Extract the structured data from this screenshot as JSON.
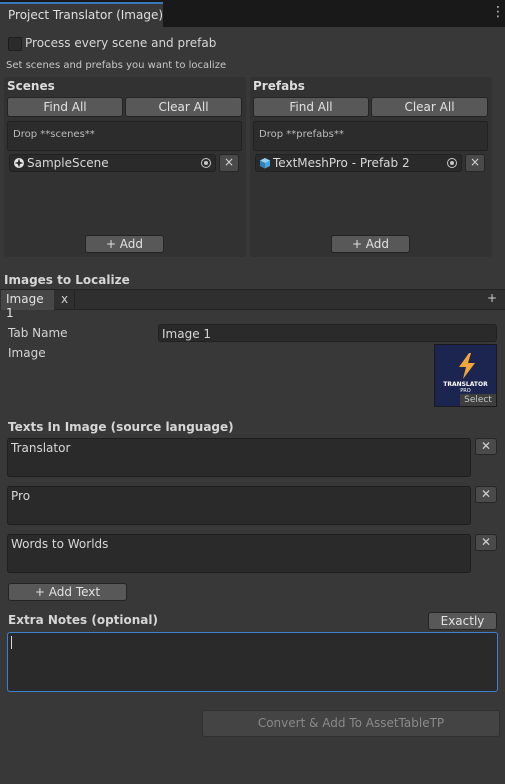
{
  "window": {
    "tab_title": "Project Translator (Image)"
  },
  "process_all": {
    "label": "Process every scene and prefab",
    "checked": false
  },
  "hint": "Set scenes and prefabs you want to localize",
  "scenes": {
    "title": "Scenes",
    "find_all": "Find All",
    "clear_all": "Clear All",
    "drop_hint": "Drop **scenes**",
    "items": [
      {
        "name": "SampleScene",
        "icon": "unity-scene-icon"
      }
    ],
    "add": "+ Add"
  },
  "prefabs": {
    "title": "Prefabs",
    "find_all": "Find All",
    "clear_all": "Clear All",
    "drop_hint": "Drop **prefabs**",
    "items": [
      {
        "name": "TextMeshPro - Prefab 2",
        "icon": "prefab-cube-icon"
      }
    ],
    "add": "+ Add"
  },
  "images": {
    "title": "Images to Localize",
    "tabs": [
      {
        "label": "Image 1",
        "close": "x"
      }
    ],
    "add_tab": "+",
    "tab_name_label": "Tab Name",
    "tab_name_value": "Image 1",
    "image_label": "Image",
    "thumbnail": {
      "line1": "TRANSLATOR",
      "line2": "PRO",
      "select": "Select"
    },
    "texts_title": "Texts In Image (source language)",
    "texts": [
      "Translator",
      "Pro",
      "Words to Worlds"
    ],
    "remove_text": "✕",
    "add_text": "+ Add Text",
    "extra_notes_title": "Extra Notes (optional)",
    "exactly": "Exactly",
    "extra_notes_value": ""
  },
  "convert_button": "Convert & Add To AssetTableTP",
  "colors": {
    "accent": "#3a79bb",
    "background": "#383838",
    "focus_border": "#3e7fd0"
  }
}
